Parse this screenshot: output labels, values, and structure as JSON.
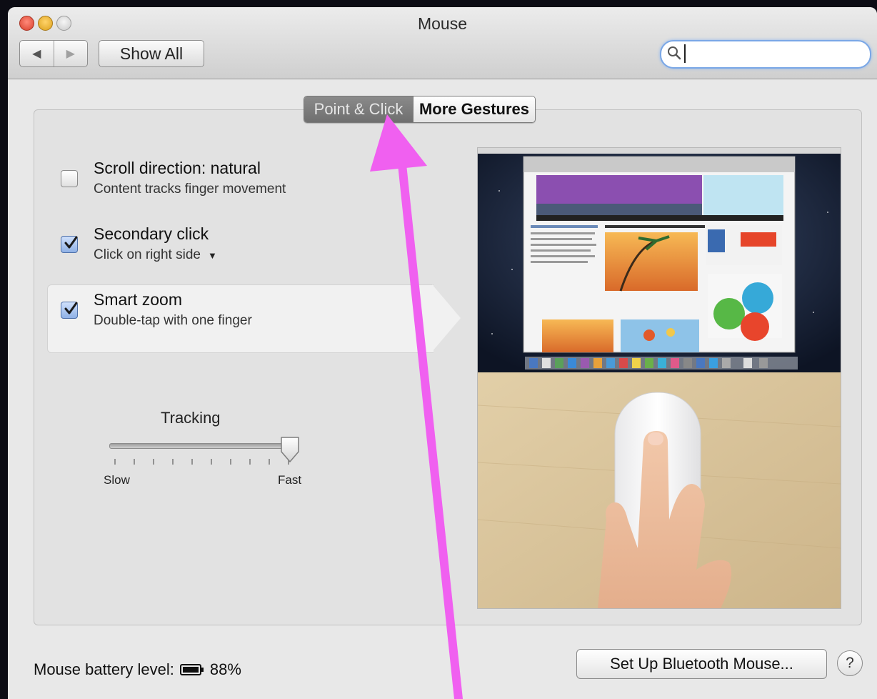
{
  "window": {
    "title": "Mouse"
  },
  "toolbar": {
    "back_icon": "◀",
    "forward_icon": "▶",
    "show_all": "Show All",
    "search_value": ""
  },
  "tabs": [
    {
      "label": "Point & Click",
      "selected": true
    },
    {
      "label": "More Gestures",
      "selected": false
    }
  ],
  "options": [
    {
      "title": "Scroll direction: natural",
      "subtitle": "Content tracks finger movement",
      "checked": false
    },
    {
      "title": "Secondary click",
      "subtitle": "Click on right side",
      "checked": true,
      "has_dropdown": true
    },
    {
      "title": "Smart zoom",
      "subtitle": "Double-tap with one finger",
      "checked": true,
      "selected": true
    }
  ],
  "tracking": {
    "label": "Tracking",
    "min_label": "Slow",
    "max_label": "Fast",
    "value_fraction": 1.0
  },
  "footer": {
    "battery_label": "Mouse battery level:",
    "battery_value": "88%",
    "setup_button": "Set Up Bluetooth Mouse...",
    "help_label": "?"
  },
  "annotation": {
    "color": "#f060f0"
  }
}
